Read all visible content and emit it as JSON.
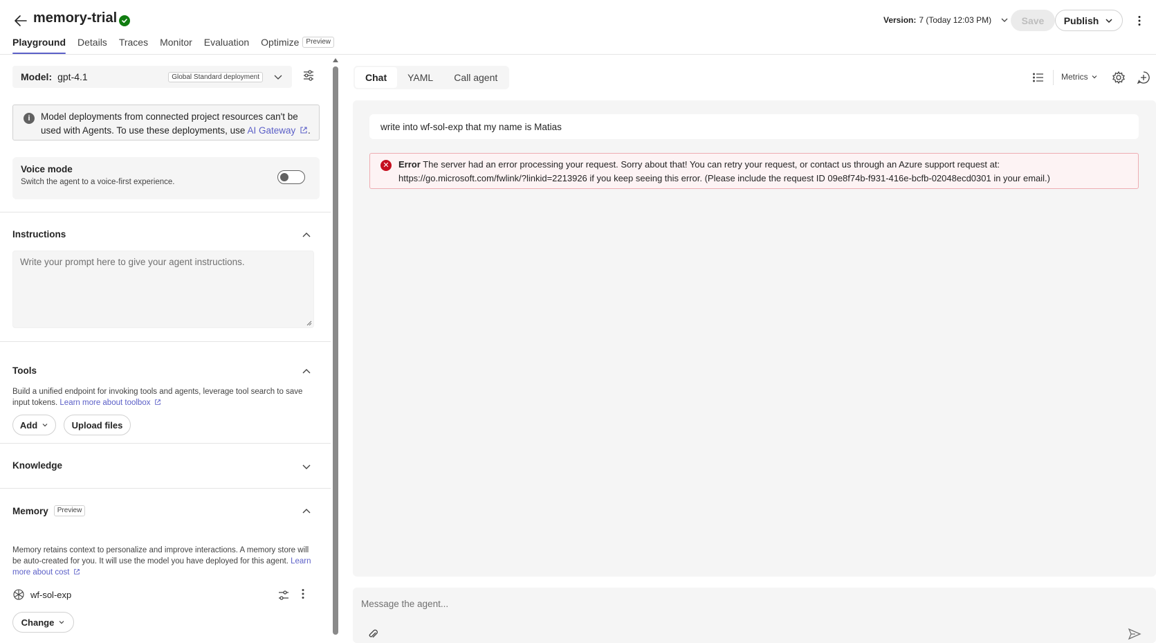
{
  "header": {
    "title": "memory-trial",
    "tabs": [
      {
        "label": "Playground"
      },
      {
        "label": "Details"
      },
      {
        "label": "Traces"
      },
      {
        "label": "Monitor"
      },
      {
        "label": "Evaluation"
      },
      {
        "label": "Optimize",
        "badge": "Preview"
      }
    ],
    "version_label": "Version:",
    "version_value": "7 (Today 12:03 PM)",
    "save_label": "Save",
    "publish_label": "Publish"
  },
  "left": {
    "model_label": "Model:",
    "model_value": "gpt-4.1",
    "deployment_badge": "Global Standard deployment",
    "info_text": "Model deployments from connected project resources can't be used with Agents. To use these deployments, use ",
    "info_link": "AI Gateway",
    "info_end": ".",
    "voice_title": "Voice mode",
    "voice_sub": "Switch the agent to a voice-first experience.",
    "instructions_title": "Instructions",
    "instructions_placeholder": "Write your prompt here to give your agent instructions.",
    "tools_title": "Tools",
    "tools_desc": "Build a unified endpoint for invoking tools and agents, leverage tool search to save input tokens. ",
    "tools_link": "Learn more about toolbox",
    "add_label": "Add",
    "upload_label": "Upload files",
    "knowledge_title": "Knowledge",
    "memory_title": "Memory",
    "memory_badge": "Preview",
    "memory_desc": "Memory retains context to personalize and improve interactions. A memory store will be auto-created for you. It will use the model you have deployed for this agent. ",
    "memory_link": "Learn more about cost",
    "memory_store": "wf-sol-exp",
    "change_label": "Change"
  },
  "right": {
    "tabs": [
      {
        "label": "Chat"
      },
      {
        "label": "YAML"
      },
      {
        "label": "Call agent"
      }
    ],
    "metrics_label": "Metrics",
    "user_message": "write into wf-sol-exp that my name is Matias",
    "error_label": "Error",
    "error_text": "The server had an error processing your request. Sorry about that! You can retry your request, or contact us through an Azure support request at: https://go.microsoft.com/fwlink/?linkid=2213926 if you keep seeing this error. (Please include the request ID 09e8f74b-f931-416e-bcfb-02048ecd0301 in your email.)",
    "composer_placeholder": "Message the agent..."
  },
  "colors": {
    "accent": "#5b5fc7",
    "success": "#107c10",
    "error": "#c50f1f",
    "error_bg": "#fdf3f4",
    "panel_bg": "#f5f5f5"
  }
}
